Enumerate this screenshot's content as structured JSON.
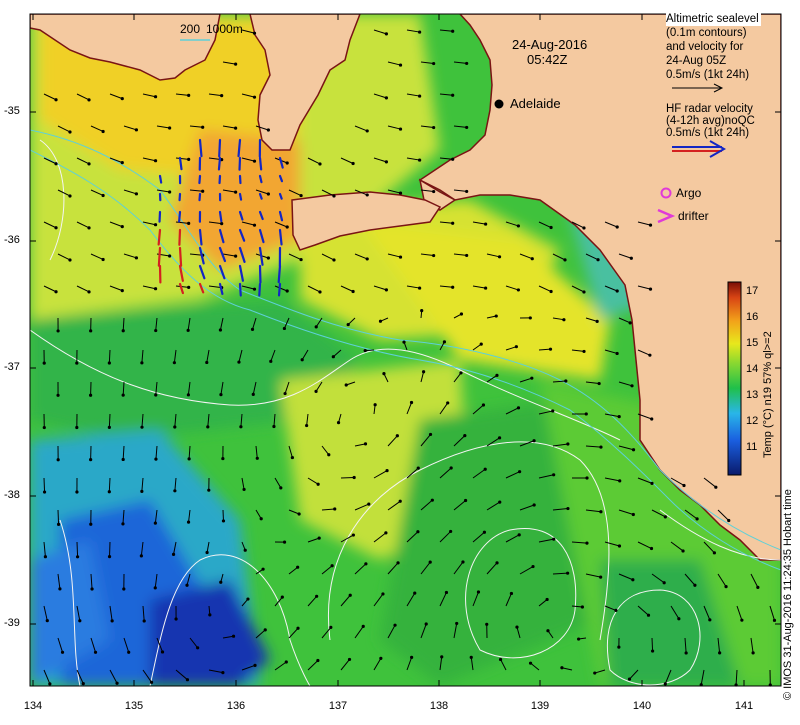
{
  "map": {
    "date": "24-Aug-2016",
    "time": "05:42Z",
    "city": "Adelaide",
    "scale_bar": "200",
    "depth_label": "1000m",
    "credit": "© IMOS 31-Aug-2016 11:24:35 Hobart time"
  },
  "legend": {
    "sealevel": [
      "Altimetric sealevel",
      "(0.1m contours)",
      "and velocity for",
      "24-Aug 05Z",
      "0.5m/s (1kt 24h)"
    ],
    "hfradar": [
      "HF radar velocity",
      "(4-12h avg)noQC",
      "0.5m/s (1kt 24h)"
    ],
    "argo": "Argo",
    "drifter": "drifter"
  },
  "axes": {
    "lon_ticks": [
      "134",
      "135",
      "136",
      "137",
      "138",
      "139",
      "140",
      "141"
    ],
    "lat_ticks": [
      "-35",
      "-36",
      "-37",
      "-38",
      "-39"
    ]
  },
  "colorbar": {
    "title": "Temp (°C) n19 57% ql>=2",
    "ticks": [
      "17",
      "16",
      "15",
      "14",
      "13",
      "12",
      "11"
    ],
    "range": [
      10.5,
      17.3
    ]
  },
  "colors": {
    "land": "#f4c9a0",
    "coast": "#7a1414",
    "hf_blue": "#1326c4",
    "hf_red": "#d42020",
    "argo": "#e03ad8"
  }
}
